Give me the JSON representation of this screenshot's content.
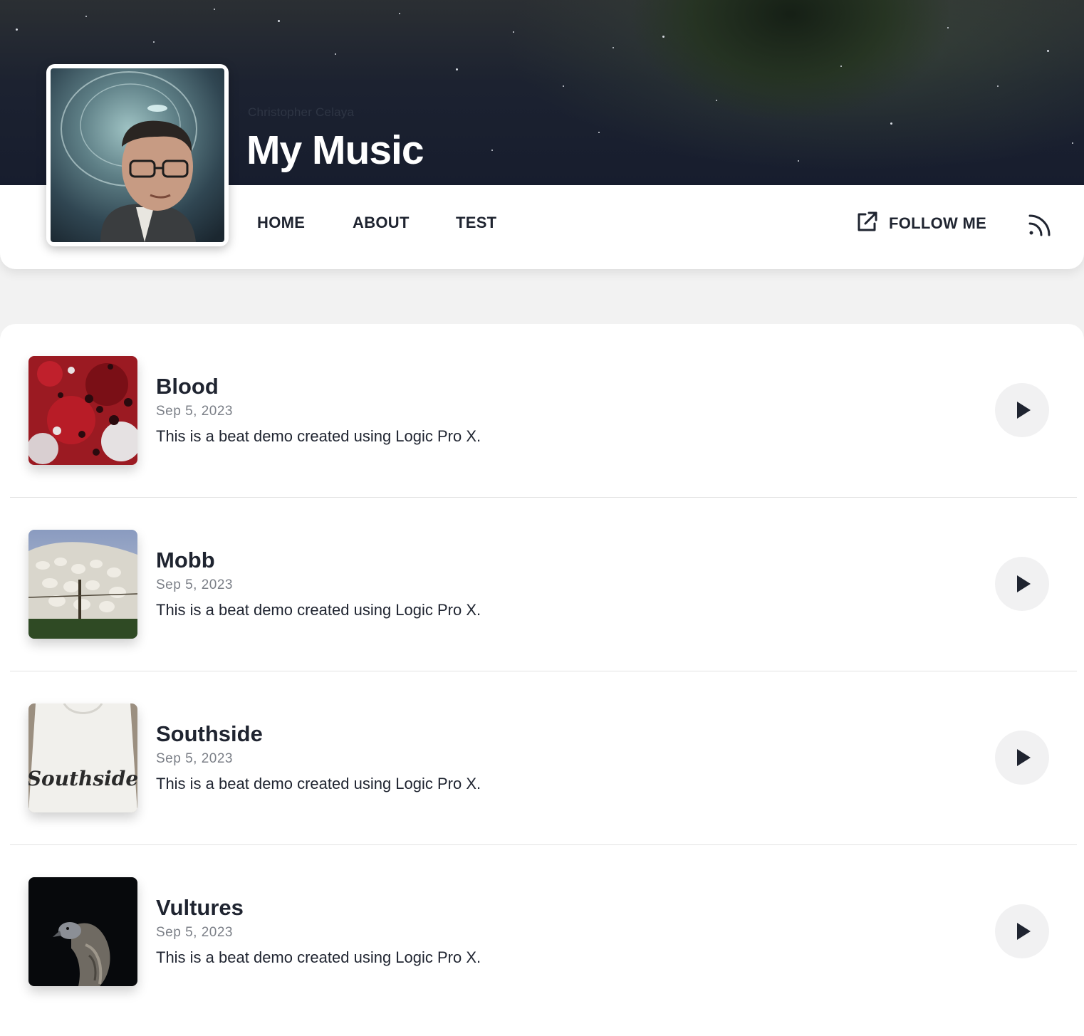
{
  "header": {
    "author": "Christopher Celaya",
    "title": "My Music"
  },
  "nav": {
    "links": [
      "HOME",
      "ABOUT",
      "TEST"
    ],
    "follow_label": "FOLLOW ME"
  },
  "icons": {
    "follow": "external-link-icon",
    "rss": "rss-icon",
    "play": "play-icon"
  },
  "tracks": [
    {
      "title": "Blood",
      "date": "Sep 5, 2023",
      "description": "This is a beat demo created using Logic Pro X."
    },
    {
      "title": "Mobb",
      "date": "Sep 5, 2023",
      "description": "This is a beat demo created using Logic Pro X."
    },
    {
      "title": "Southside",
      "date": "Sep 5, 2023",
      "description": "This is a beat demo created using Logic Pro X."
    },
    {
      "title": "Vultures",
      "date": "Sep 5, 2023",
      "description": "This is a beat demo created using Logic Pro X."
    }
  ],
  "artwork_text": {
    "southside": "Southside"
  },
  "colors": {
    "text": "#1f2430",
    "muted": "#7b7f87",
    "banner": "#171d2e",
    "page_bg": "#f2f2f2"
  }
}
